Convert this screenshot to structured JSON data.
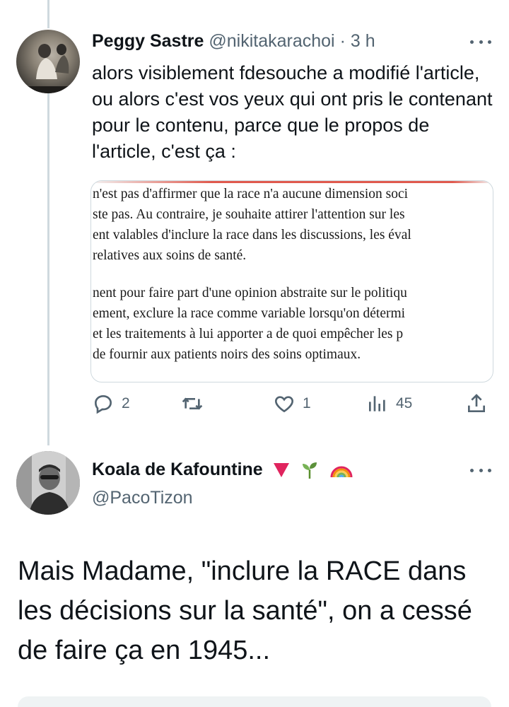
{
  "tweet1": {
    "display_name": "Peggy Sastre",
    "handle": "@nikitakarachoi",
    "separator": "·",
    "time": "3 h",
    "text": "alors visiblement fdesouche a modifié l'article, ou alors c'est vos yeux qui ont pris le contenant pour le contenu, parce que le propos de l'article, c'est ça :",
    "image_text": {
      "para1": [
        "n'est pas d'affirmer que la race n'a aucune dimension soci",
        "ste pas. Au contraire, je souhaite attirer l'attention sur les",
        "ent valables d'inclure la race dans les discussions, les éval",
        " relatives aux soins de santé."
      ],
      "para2": [
        "nent pour faire part d'une opinion abstraite sur le politiqu",
        "ement, exclure la race comme variable lorsqu'on détermi",
        "et les traitements à lui apporter a de quoi empêcher les p",
        " de fournir aux patients noirs des soins optimaux."
      ]
    },
    "actions": {
      "replies": "2",
      "retweets": "",
      "likes": "1",
      "views": "45"
    }
  },
  "tweet2": {
    "display_name": "Koala de Kafountine",
    "handle": "@PacoTizon",
    "emojis": [
      "down-red-triangle",
      "seedling",
      "rainbow"
    ],
    "text": "Mais Madame, \"inclure la RACE dans les décisions sur la santé\", on a cessé de faire ça en 1945..."
  },
  "colors": {
    "text": "#0f1419",
    "secondary": "#536471",
    "border": "#cfd9de"
  }
}
